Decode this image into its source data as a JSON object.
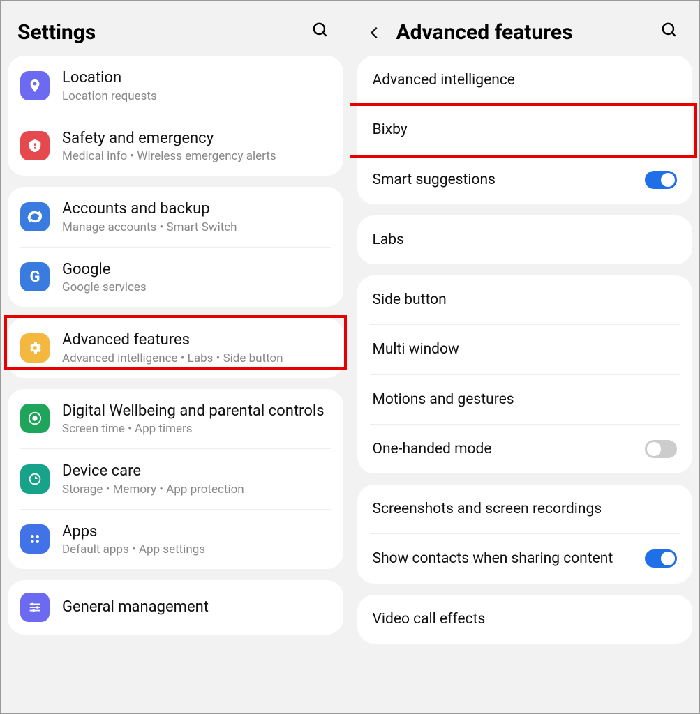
{
  "left": {
    "title": "Settings",
    "groups": [
      {
        "items": [
          {
            "id": "location",
            "title": "Location",
            "sub": "Location requests"
          },
          {
            "id": "safety",
            "title": "Safety and emergency",
            "sub": "Medical info  •  Wireless emergency alerts"
          }
        ]
      },
      {
        "items": [
          {
            "id": "accounts",
            "title": "Accounts and backup",
            "sub": "Manage accounts  •  Smart Switch"
          },
          {
            "id": "google",
            "title": "Google",
            "sub": "Google services"
          }
        ]
      },
      {
        "highlight": true,
        "items": [
          {
            "id": "advanced",
            "title": "Advanced features",
            "sub": "Advanced intelligence  •  Labs  •  Side button"
          }
        ]
      },
      {
        "items": [
          {
            "id": "wellbeing",
            "title": "Digital Wellbeing and parental controls",
            "sub": "Screen time  •  App timers"
          },
          {
            "id": "devicecare",
            "title": "Device care",
            "sub": "Storage  •  Memory  •  App protection"
          },
          {
            "id": "apps",
            "title": "Apps",
            "sub": "Default apps  •  App settings"
          }
        ]
      },
      {
        "items": [
          {
            "id": "general",
            "title": "General management",
            "sub": ""
          }
        ]
      }
    ]
  },
  "right": {
    "title": "Advanced features",
    "groups": [
      {
        "items": [
          {
            "id": "adv-intel",
            "title": "Advanced intelligence"
          },
          {
            "id": "bixby",
            "title": "Bixby",
            "highlight": true
          },
          {
            "id": "smart-sugg",
            "title": "Smart suggestions",
            "toggle": "on"
          }
        ]
      },
      {
        "items": [
          {
            "id": "labs",
            "title": "Labs"
          }
        ]
      },
      {
        "items": [
          {
            "id": "side-button",
            "title": "Side button"
          },
          {
            "id": "multi-window",
            "title": "Multi window"
          },
          {
            "id": "motions",
            "title": "Motions and gestures"
          },
          {
            "id": "one-handed",
            "title": "One-handed mode",
            "toggle": "off"
          }
        ]
      },
      {
        "items": [
          {
            "id": "screenshots",
            "title": "Screenshots and screen recordings"
          },
          {
            "id": "show-contacts",
            "title": "Show contacts when sharing content",
            "toggle": "on"
          }
        ]
      },
      {
        "items": [
          {
            "id": "video-call",
            "title": "Video call effects"
          }
        ]
      }
    ]
  }
}
